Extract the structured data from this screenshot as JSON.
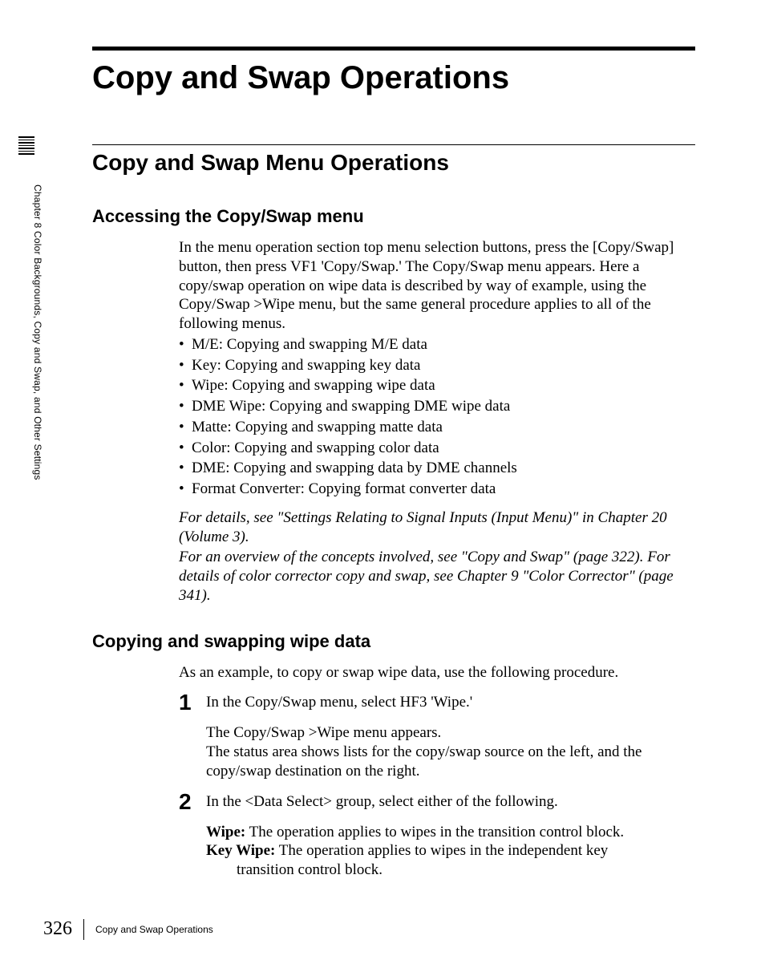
{
  "sidebar": {
    "chapter_label": "Chapter 8   Color Backgrounds, Copy and Swap, and Other Settings"
  },
  "title": "Copy and Swap Operations",
  "section1": {
    "heading": "Copy and Swap Menu Operations",
    "sub1": {
      "heading": "Accessing the Copy/Swap menu",
      "intro": "In the menu operation section top menu selection buttons, press the [Copy/Swap] button, then press VF1 'Copy/Swap.' The Copy/Swap menu appears. Here a copy/swap operation on wipe data is described by way of example, using the Copy/Swap >Wipe menu, but the same general procedure applies to all of the following menus.",
      "bullets": [
        "M/E: Copying and swapping M/E data",
        "Key: Copying and swapping key data",
        "Wipe: Copying and swapping wipe data",
        "DME Wipe: Copying and swapping DME wipe data",
        "Matte: Copying and swapping matte data",
        "Color: Copying and swapping color data",
        "DME: Copying and swapping data by DME channels",
        "Format Converter: Copying format converter data"
      ],
      "note1": "For details, see \"Settings Relating to Signal Inputs (Input Menu)\" in Chapter 20 (Volume 3).",
      "note2": "For an overview of the concepts involved, see \"Copy and Swap\" (page 322). For details of color corrector copy and swap, see Chapter 9 \"Color Corrector\" (page 341)."
    },
    "sub2": {
      "heading": "Copying and swapping wipe data",
      "intro": "As an example, to copy or swap wipe data, use the following procedure.",
      "steps": [
        {
          "num": "1",
          "line1": "In the Copy/Swap menu, select HF3 'Wipe.'",
          "para": "The Copy/Swap >Wipe menu appears.\nThe status area shows lists for the copy/swap source on the left, and the copy/swap destination on the right."
        },
        {
          "num": "2",
          "line1": "In the <Data Select> group, select either of the following.",
          "defs": [
            {
              "term": "Wipe:",
              "rest": " The operation applies to wipes in the transition control block."
            },
            {
              "term": "Key Wipe:",
              "rest": " The operation applies to wipes in the independent key",
              "cont": "transition control block."
            }
          ]
        }
      ]
    }
  },
  "footer": {
    "page": "326",
    "text": "Copy and Swap Operations"
  }
}
